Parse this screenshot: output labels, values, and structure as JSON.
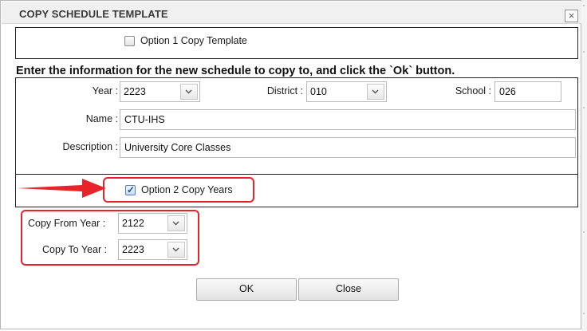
{
  "dialog": {
    "title": "COPY SCHEDULE TEMPLATE",
    "close_glyph": "×"
  },
  "option1": {
    "label": "Option 1 Copy Template",
    "checked": false
  },
  "instructions": "Enter the information for the new schedule to copy to, and click the `Ok` button.",
  "form": {
    "year_label": "Year :",
    "year_value": "2223",
    "district_label": "District :",
    "district_value": "010",
    "school_label": "School :",
    "school_value": "026",
    "name_label": "Name :",
    "name_value": "CTU-IHS",
    "description_label": "Description :",
    "description_value": "University Core Classes"
  },
  "option2": {
    "label": "Option 2 Copy Years",
    "checked": true
  },
  "copy_years": {
    "from_label": "Copy From Year :",
    "from_value": "2122",
    "to_label": "Copy To Year :",
    "to_value": "2223"
  },
  "buttons": {
    "ok_label": "OK",
    "close_label": "Close"
  },
  "colors": {
    "annotation_red": "#e8232a",
    "dialog_title_bg": "#f0f0f0",
    "checkbox_checked": "#1b4f95"
  },
  "icons": {
    "combo_arrow": "chevron-down-icon",
    "close": "close-icon",
    "annotation_arrow": "arrow-right-icon"
  }
}
